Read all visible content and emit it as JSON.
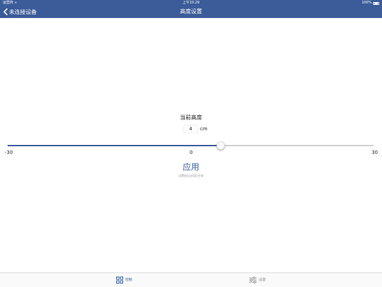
{
  "status_bar": {
    "carrier": "运营商",
    "time": "上午10:29",
    "battery": "100%"
  },
  "nav": {
    "back_label": "未连接设备",
    "title": "高度设置"
  },
  "height": {
    "label": "当前高度",
    "value": "4",
    "unit": "cm"
  },
  "slider": {
    "min_label": "-30",
    "mid_label": "0",
    "max_label": "30",
    "min": -30,
    "max": 30,
    "value": 4
  },
  "apply": {
    "label": "应用",
    "hint": "设置前后应用后生效"
  },
  "tabs": [
    {
      "label": "控制",
      "icon": "grid-icon",
      "active": true
    },
    {
      "label": "设置",
      "icon": "sliders-icon",
      "active": false
    }
  ],
  "colors": {
    "accent": "#3b5c99",
    "track_inactive": "#d0d0d0"
  }
}
